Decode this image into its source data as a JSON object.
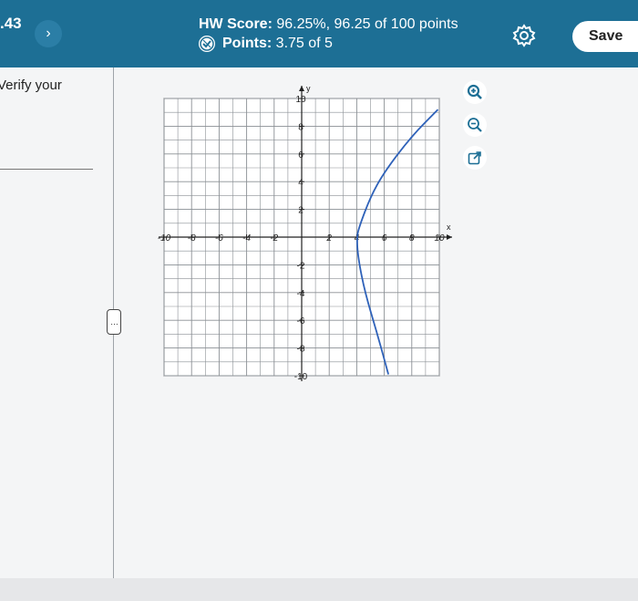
{
  "header": {
    "question_number": ".43",
    "next_label": "›",
    "hw_score_label": "HW Score:",
    "hw_score_value": "96.25%, 96.25 of 100 points",
    "points_label": "Points:",
    "points_value": "3.75 of 5",
    "save_label": "Save",
    "bg_color": "#1d6f95"
  },
  "question": {
    "verify_text": "Verify your",
    "more_label": "…"
  },
  "tools": {
    "zoom_in_icon": "zoom-in-icon",
    "zoom_out_icon": "zoom-out-icon",
    "popout_icon": "external-link-icon"
  },
  "chart_data": {
    "type": "line",
    "x_axis_label": "x",
    "y_axis_label": "y",
    "xlim": [
      -10,
      10
    ],
    "ylim": [
      -10,
      10
    ],
    "grid": true,
    "x_ticks": [
      "-10",
      "-8",
      "-6",
      "-4",
      "-2",
      "2",
      "4",
      "6",
      "8",
      "10"
    ],
    "y_ticks": [
      "10",
      "8",
      "6",
      "4",
      "2",
      "-2",
      "-4",
      "-6",
      "-8",
      "-10"
    ],
    "series": [
      {
        "color": "#2f62b9",
        "points": [
          [
            9.9,
            9.2
          ],
          [
            8,
            7.3
          ],
          [
            6,
            4.7
          ],
          [
            5,
            2.9
          ],
          [
            4.2,
            0.8
          ],
          [
            4,
            0
          ],
          [
            4.1,
            -1.5
          ],
          [
            4.6,
            -4
          ],
          [
            5.5,
            -7
          ],
          [
            6.3,
            -9.9
          ]
        ]
      }
    ]
  }
}
